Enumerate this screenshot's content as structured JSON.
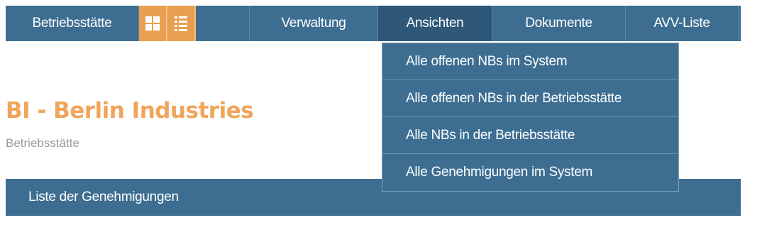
{
  "navbar": {
    "brand_label": "Betriebsstätte",
    "grid_view_icon": "grid-icon",
    "list_view_icon": "list-icon",
    "items": [
      {
        "label": "Verwaltung"
      },
      {
        "label": "Ansichten"
      },
      {
        "label": "Dokumente"
      },
      {
        "label": "AVV-Liste"
      }
    ],
    "active_item": "Ansichten",
    "colors": {
      "bar": "#3d6e92",
      "active": "#2e5778",
      "view_buttons": "#e8a050"
    }
  },
  "dropdown": {
    "items": [
      {
        "label": "Alle offenen NBs im System"
      },
      {
        "label": "Alle offenen NBs in der Betriebsstätte"
      },
      {
        "label": "Alle NBs in der Betriebsstätte"
      },
      {
        "label": "Alle Genehmigungen im System"
      }
    ]
  },
  "page": {
    "title": "BI - Berlin Industries",
    "subtitle": "Betriebsstätte",
    "title_color": "#f0a55a"
  },
  "section": {
    "title": "Liste der Genehmigungen"
  }
}
